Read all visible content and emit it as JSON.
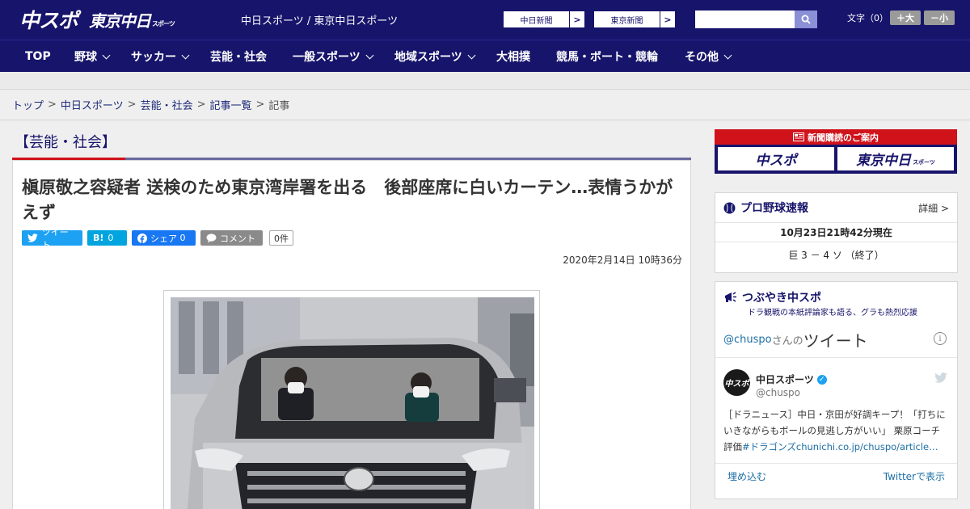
{
  "header": {
    "logo_chuspo": "中スポ",
    "logo_tokyo": "東京中日",
    "logo_tokyo_sub": "スポーツ",
    "site_links": "中日スポーツ / 東京中日スポーツ",
    "paper_buttons": [
      "中日新聞",
      "東京新聞"
    ],
    "font_size_label": "文字（0）",
    "font_up": "＋大",
    "font_down": "－小"
  },
  "nav": {
    "items": [
      "TOP",
      "野球",
      "サッカー",
      "芸能・社会",
      "一般スポーツ",
      "地域スポーツ",
      "大相撲",
      "競馬・ボート・競輪",
      "その他"
    ]
  },
  "breadcrumb": [
    "トップ",
    "中日スポーツ",
    "芸能・社会",
    "記事一覧",
    "記事"
  ],
  "article": {
    "category": "【芸能・社会】",
    "headline": "槇原敬之容疑者 送検のため東京湾岸署を出る　後部座席に白いカーテン…表情うかがえず",
    "social": {
      "tweet": "ツイート",
      "hatena_icon": "B!",
      "hatena_count": "0",
      "facebook": "シェア",
      "facebook_count": "0",
      "comment": "コメント",
      "comment_count": "0件"
    },
    "date": "2020年2月14日 10時36分"
  },
  "sidebar": {
    "subscribe_label": "新聞購読のご案内",
    "subscribe_logos": [
      "中スポ",
      "東京中日"
    ],
    "subscribe_logo_sub": "スポーツ",
    "baseball": {
      "title": "プロ野球速報",
      "detail": "詳細 >",
      "timestamp": "10月23日21時42分現在",
      "score": "巨 3 － 4 ソ （終了）"
    },
    "tweets": {
      "title": "つぶやき中スポ",
      "subtitle": "ドラ観戦の本紙評論家も語る、グラも熱烈応援",
      "handle": "@chuspo",
      "handle_suffix": "さんの",
      "word": "ツイート",
      "info_icon": "i",
      "account_name": "中日スポーツ",
      "account_user": "@chuspo",
      "avatar_text": "中スポ",
      "tweet_text": "［ドラニュース］中日・京田が好調キープ！「打ちにいきながらもボールの見逃し方がいい」 栗原コーチ評価",
      "tweet_link": "#ドラゴンズchunichi.co.jp/chuspo/article…",
      "embed": "埋め込む",
      "view_on_twitter": "Twitterで表示"
    }
  },
  "colors": {
    "brand_navy": "#17146b",
    "accent_red": "#d0121b",
    "twitter_blue": "#1da1f2",
    "facebook_blue": "#1877f2",
    "hatena_blue": "#00a4de",
    "link_blue": "#1d6fa5"
  }
}
